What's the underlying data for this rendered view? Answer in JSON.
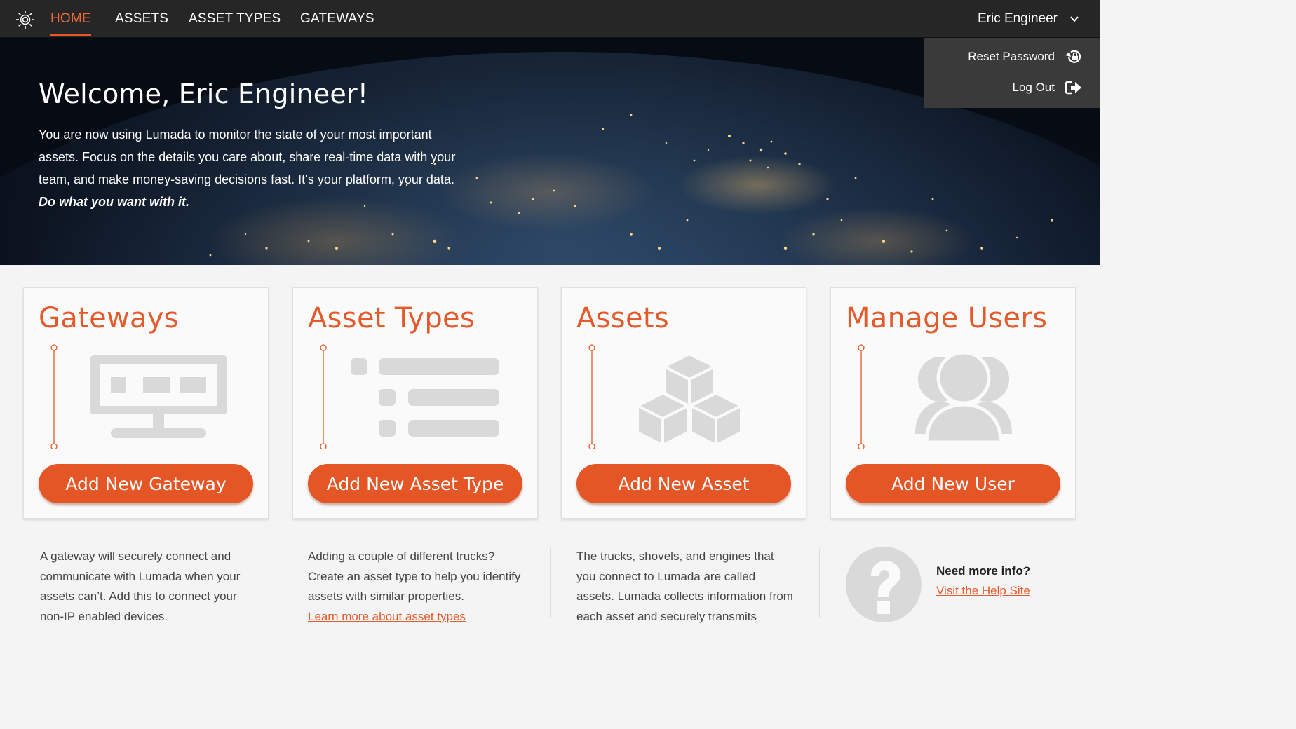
{
  "nav": {
    "items": [
      {
        "label": "HOME",
        "active": true
      },
      {
        "label": "ASSETS",
        "active": false
      },
      {
        "label": "ASSET TYPES",
        "active": false
      },
      {
        "label": "GATEWAYS",
        "active": false
      }
    ],
    "user_name": "Eric Engineer",
    "accent_color": "#e8562a"
  },
  "user_dropdown": {
    "items": [
      {
        "label": "Reset Password",
        "icon": "reset-password-icon"
      },
      {
        "label": "Log Out",
        "icon": "logout-icon"
      }
    ]
  },
  "hero": {
    "title": "Welcome, Eric Engineer!",
    "text": "You are now using Lumada to monitor the state of your most important assets. Focus on the details you care about, share real-time data with your team, and make money-saving decisions fast. It’s your platform, your data.",
    "emphasis": "Do what you want with it."
  },
  "cards": [
    {
      "title": "Gateways",
      "icon": "gateway-icon",
      "button": "Add New Gateway"
    },
    {
      "title": "Asset Types",
      "icon": "list-icon",
      "button": "Add New Asset Type"
    },
    {
      "title": "Assets",
      "icon": "cubes-icon",
      "button": "Add New Asset"
    },
    {
      "title": "Manage Users",
      "icon": "users-icon",
      "button": "Add New User"
    }
  ],
  "descriptions": [
    {
      "text": "A gateway will securely connect and communicate with Lumada when your assets can’t. Add this to connect your non-IP enabled devices."
    },
    {
      "text": "Adding a couple of different trucks? Create an asset type to help you identify assets with similar properties.",
      "link": "Learn more about asset types"
    },
    {
      "text": "The trucks, shovels, and engines that you connect to Lumada are called assets. Lumada collects information from each asset and securely transmits"
    }
  ],
  "help": {
    "icon": "help-question-icon",
    "title": "Need more info?",
    "link": "Visit the Help Site"
  },
  "colors": {
    "brand_orange": "#e55626",
    "topbar": "#262626",
    "dropdown": "#3a3a3a",
    "icon_gray": "#d9d9d9"
  }
}
